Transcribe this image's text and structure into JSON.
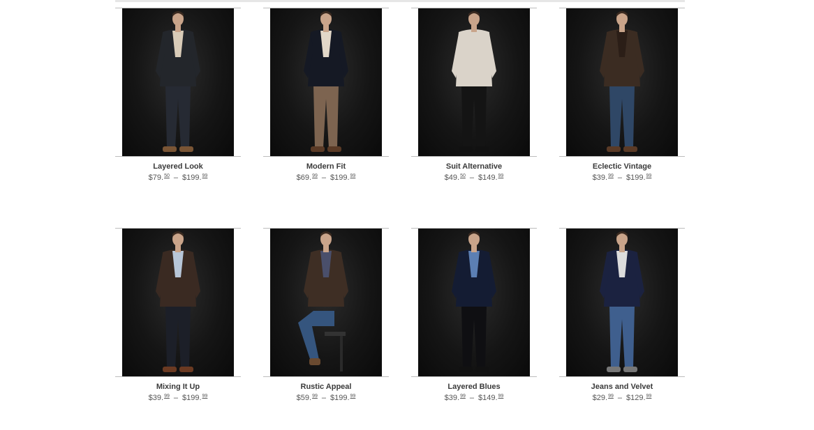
{
  "colors": {
    "background": "#ffffff",
    "photo_bg": "#111111",
    "text": "#3a3a3a",
    "rule": "#bdbdbd"
  },
  "products": [
    {
      "name": "Layered Look",
      "price_low": {
        "dollars": "$79.",
        "cents": "50"
      },
      "price_high": {
        "dollars": "$199.",
        "cents": "99"
      },
      "outfit": {
        "jacket": "#23262b",
        "inner": "#d8cbb8",
        "pants": "#262a33",
        "shoes": "#7a5535",
        "shirt": "#b7c4d3"
      }
    },
    {
      "name": "Modern Fit",
      "price_low": {
        "dollars": "$69.",
        "cents": "99"
      },
      "price_high": {
        "dollars": "$199.",
        "cents": "99"
      },
      "outfit": {
        "jacket": "#151924",
        "inner": "#e2d7c8",
        "pants": "#7d6450",
        "shoes": "#5a3a26",
        "shirt": "#e2d7c8"
      }
    },
    {
      "name": "Suit Alternative",
      "price_low": {
        "dollars": "$49.",
        "cents": "50"
      },
      "price_high": {
        "dollars": "$149.",
        "cents": "99"
      },
      "outfit": {
        "jacket": "#dad3c9",
        "inner": "#dad3c9",
        "pants": "#141414",
        "shoes": "#111111",
        "shirt": "#ffffff"
      }
    },
    {
      "name": "Eclectic Vintage",
      "price_low": {
        "dollars": "$39.",
        "cents": "99"
      },
      "price_high": {
        "dollars": "$199.",
        "cents": "99"
      },
      "outfit": {
        "jacket": "#3b2c22",
        "inner": "#2b1e17",
        "pants": "#2f4766",
        "shoes": "#5a3a26",
        "shirt": "#3a2a20"
      }
    },
    {
      "name": "Mixing It Up",
      "price_low": {
        "dollars": "$39.",
        "cents": "99"
      },
      "price_high": {
        "dollars": "$199.",
        "cents": "99"
      },
      "outfit": {
        "jacket": "#3a2a22",
        "inner": "#b8c6d8",
        "pants": "#1c1f28",
        "shoes": "#6b3a22",
        "shirt": "#b8c6d8"
      }
    },
    {
      "name": "Rustic Appeal",
      "price_low": {
        "dollars": "$59.",
        "cents": "99"
      },
      "price_high": {
        "dollars": "$199.",
        "cents": "99"
      },
      "outfit": {
        "jacket": "#3e2e24",
        "inner": "#4a4f6b",
        "pants": "#35557e",
        "shoes": "#6a4a30",
        "shirt": "#4a4f6b"
      }
    },
    {
      "name": "Layered Blues",
      "price_low": {
        "dollars": "$39.",
        "cents": "99"
      },
      "price_high": {
        "dollars": "$149.",
        "cents": "99"
      },
      "outfit": {
        "jacket": "#141c33",
        "inner": "#5c7fb3",
        "pants": "#0f0f12",
        "shoes": "#111111",
        "shirt": "#5c7fb3"
      }
    },
    {
      "name": "Jeans and Velvet",
      "price_low": {
        "dollars": "$29.",
        "cents": "99"
      },
      "price_high": {
        "dollars": "$129.",
        "cents": "99"
      },
      "outfit": {
        "jacket": "#1b2240",
        "inner": "#dcdcdc",
        "pants": "#3f5f8e",
        "shoes": "#777777",
        "shirt": "#dcdcdc"
      }
    }
  ]
}
